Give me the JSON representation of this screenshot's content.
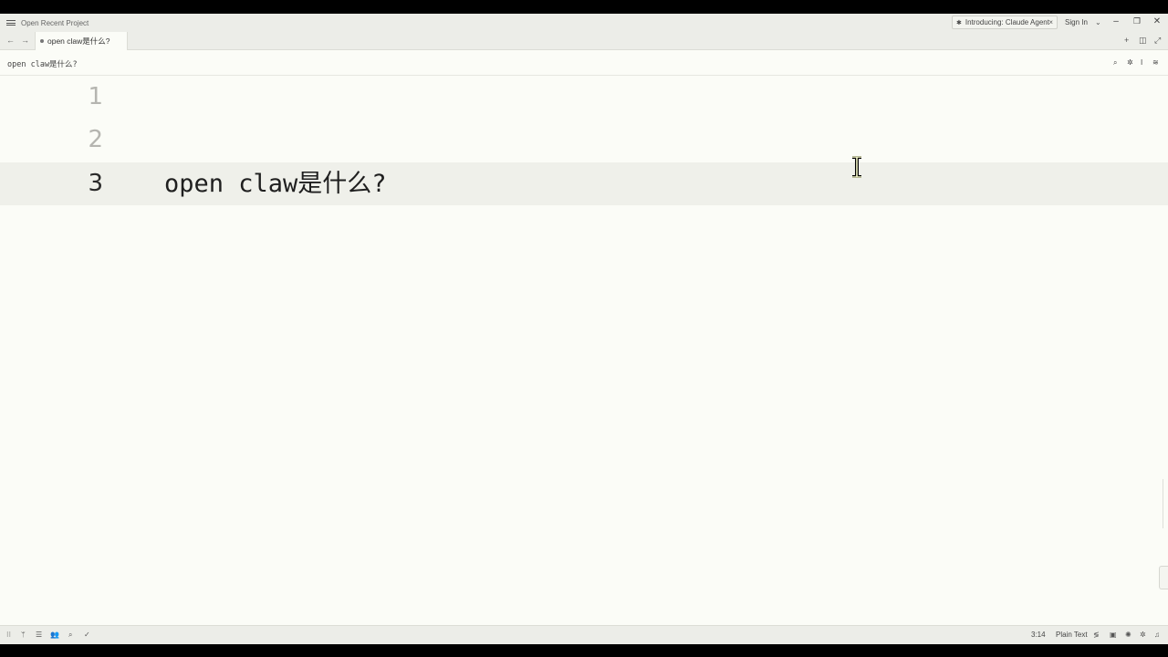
{
  "titlebar": {
    "project_title": "Open Recent Project",
    "announcement": "Introducing: Claude Agent",
    "announcement_icon": "sparkle-icon",
    "sign_in": "Sign In"
  },
  "tab": {
    "label": "open claw是什么?"
  },
  "breadcrumb": {
    "text": "open claw是什么?"
  },
  "editor": {
    "lines": [
      {
        "number": "1",
        "text": ""
      },
      {
        "number": "2",
        "text": ""
      },
      {
        "number": "3",
        "text": "open claw是什么?"
      }
    ],
    "active_line": 3
  },
  "statusbar": {
    "cursor_position": "3:14",
    "language": "Plain Text"
  },
  "colors": {
    "editor_bg": "#fbfcf7",
    "chrome_bg": "#ecede8",
    "active_line_bg": "#eff0ea"
  }
}
